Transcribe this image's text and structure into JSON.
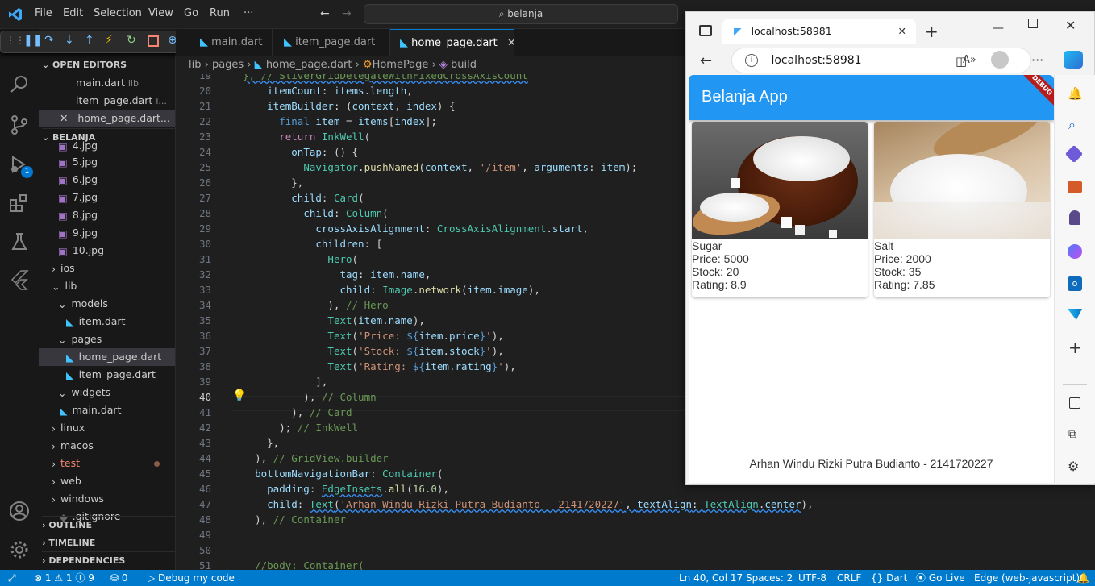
{
  "menu": [
    "File",
    "Edit",
    "Selection",
    "View",
    "Go",
    "Run",
    "···"
  ],
  "command_center": "belanja",
  "tabs": [
    {
      "label": "main.dart"
    },
    {
      "label": "item_page.dart"
    },
    {
      "label": "home_page.dart"
    }
  ],
  "breadcrumb": {
    "parts": [
      "lib",
      "pages",
      "home_page.dart",
      "HomePage",
      "build"
    ]
  },
  "sidebar": {
    "open_editors_title": "OPEN EDITORS",
    "open_editors": [
      {
        "label": "main.dart",
        "hint": "lib"
      },
      {
        "label": "item_page.dart",
        "hint": "l..."
      },
      {
        "label": "home_page.dart..."
      }
    ],
    "project_title": "BELANJA",
    "tree": [
      {
        "label": "4.jpg"
      },
      {
        "label": "5.jpg"
      },
      {
        "label": "6.jpg"
      },
      {
        "label": "7.jpg"
      },
      {
        "label": "8.jpg"
      },
      {
        "label": "9.jpg"
      },
      {
        "label": "10.jpg"
      },
      {
        "label": "ios"
      },
      {
        "label": "lib"
      },
      {
        "label": "models"
      },
      {
        "label": "item.dart"
      },
      {
        "label": "pages"
      },
      {
        "label": "home_page.dart"
      },
      {
        "label": "item_page.dart"
      },
      {
        "label": "widgets"
      },
      {
        "label": "main.dart"
      },
      {
        "label": "linux"
      },
      {
        "label": "macos"
      },
      {
        "label": "test"
      },
      {
        "label": "web"
      },
      {
        "label": "windows"
      },
      {
        "label": ".gitignore"
      }
    ],
    "outline": "OUTLINE",
    "timeline": "TIMELINE",
    "dependencies": "DEPENDENCIES",
    "debug_badge": "1"
  },
  "code": {
    "line_numbers": [
      "19",
      "20",
      "21",
      "22",
      "23",
      "24",
      "25",
      "26",
      "27",
      "28",
      "29",
      "30",
      "31",
      "32",
      "33",
      "34",
      "35",
      "36",
      "37",
      "38",
      "39",
      "40",
      "41",
      "42",
      "43",
      "44",
      "45",
      "46",
      "47",
      "48",
      "49",
      "50",
      "51"
    ],
    "current_line": "40"
  },
  "browser": {
    "tab_title": "localhost:58981",
    "address": "localhost:58981",
    "app_title": "Belanja App",
    "debug_banner": "DEBUG",
    "items": [
      {
        "name": "Sugar",
        "price": "Price: 5000",
        "stock": "Stock: 20",
        "rating": "Rating: 8.9"
      },
      {
        "name": "Salt",
        "price": "Price: 2000",
        "stock": "Stock: 35",
        "rating": "Rating: 7.85"
      }
    ],
    "footer": "Arhan Windu Rizki Putra Budianto - 2141720227"
  },
  "status": {
    "errors": "1",
    "warnings": "1",
    "infos": "9",
    "ports": "0",
    "debug": "Debug my code",
    "position": "Ln 40, Col 17",
    "spaces": "Spaces: 2",
    "encoding": "UTF-8",
    "eol": "CRLF",
    "language": "Dart",
    "golive": "Go Live",
    "device": "Edge (web-javascript)"
  },
  "colors": {
    "accent": "#007acc",
    "app_bar": "#2196f3",
    "status_bar": "#007acc"
  }
}
